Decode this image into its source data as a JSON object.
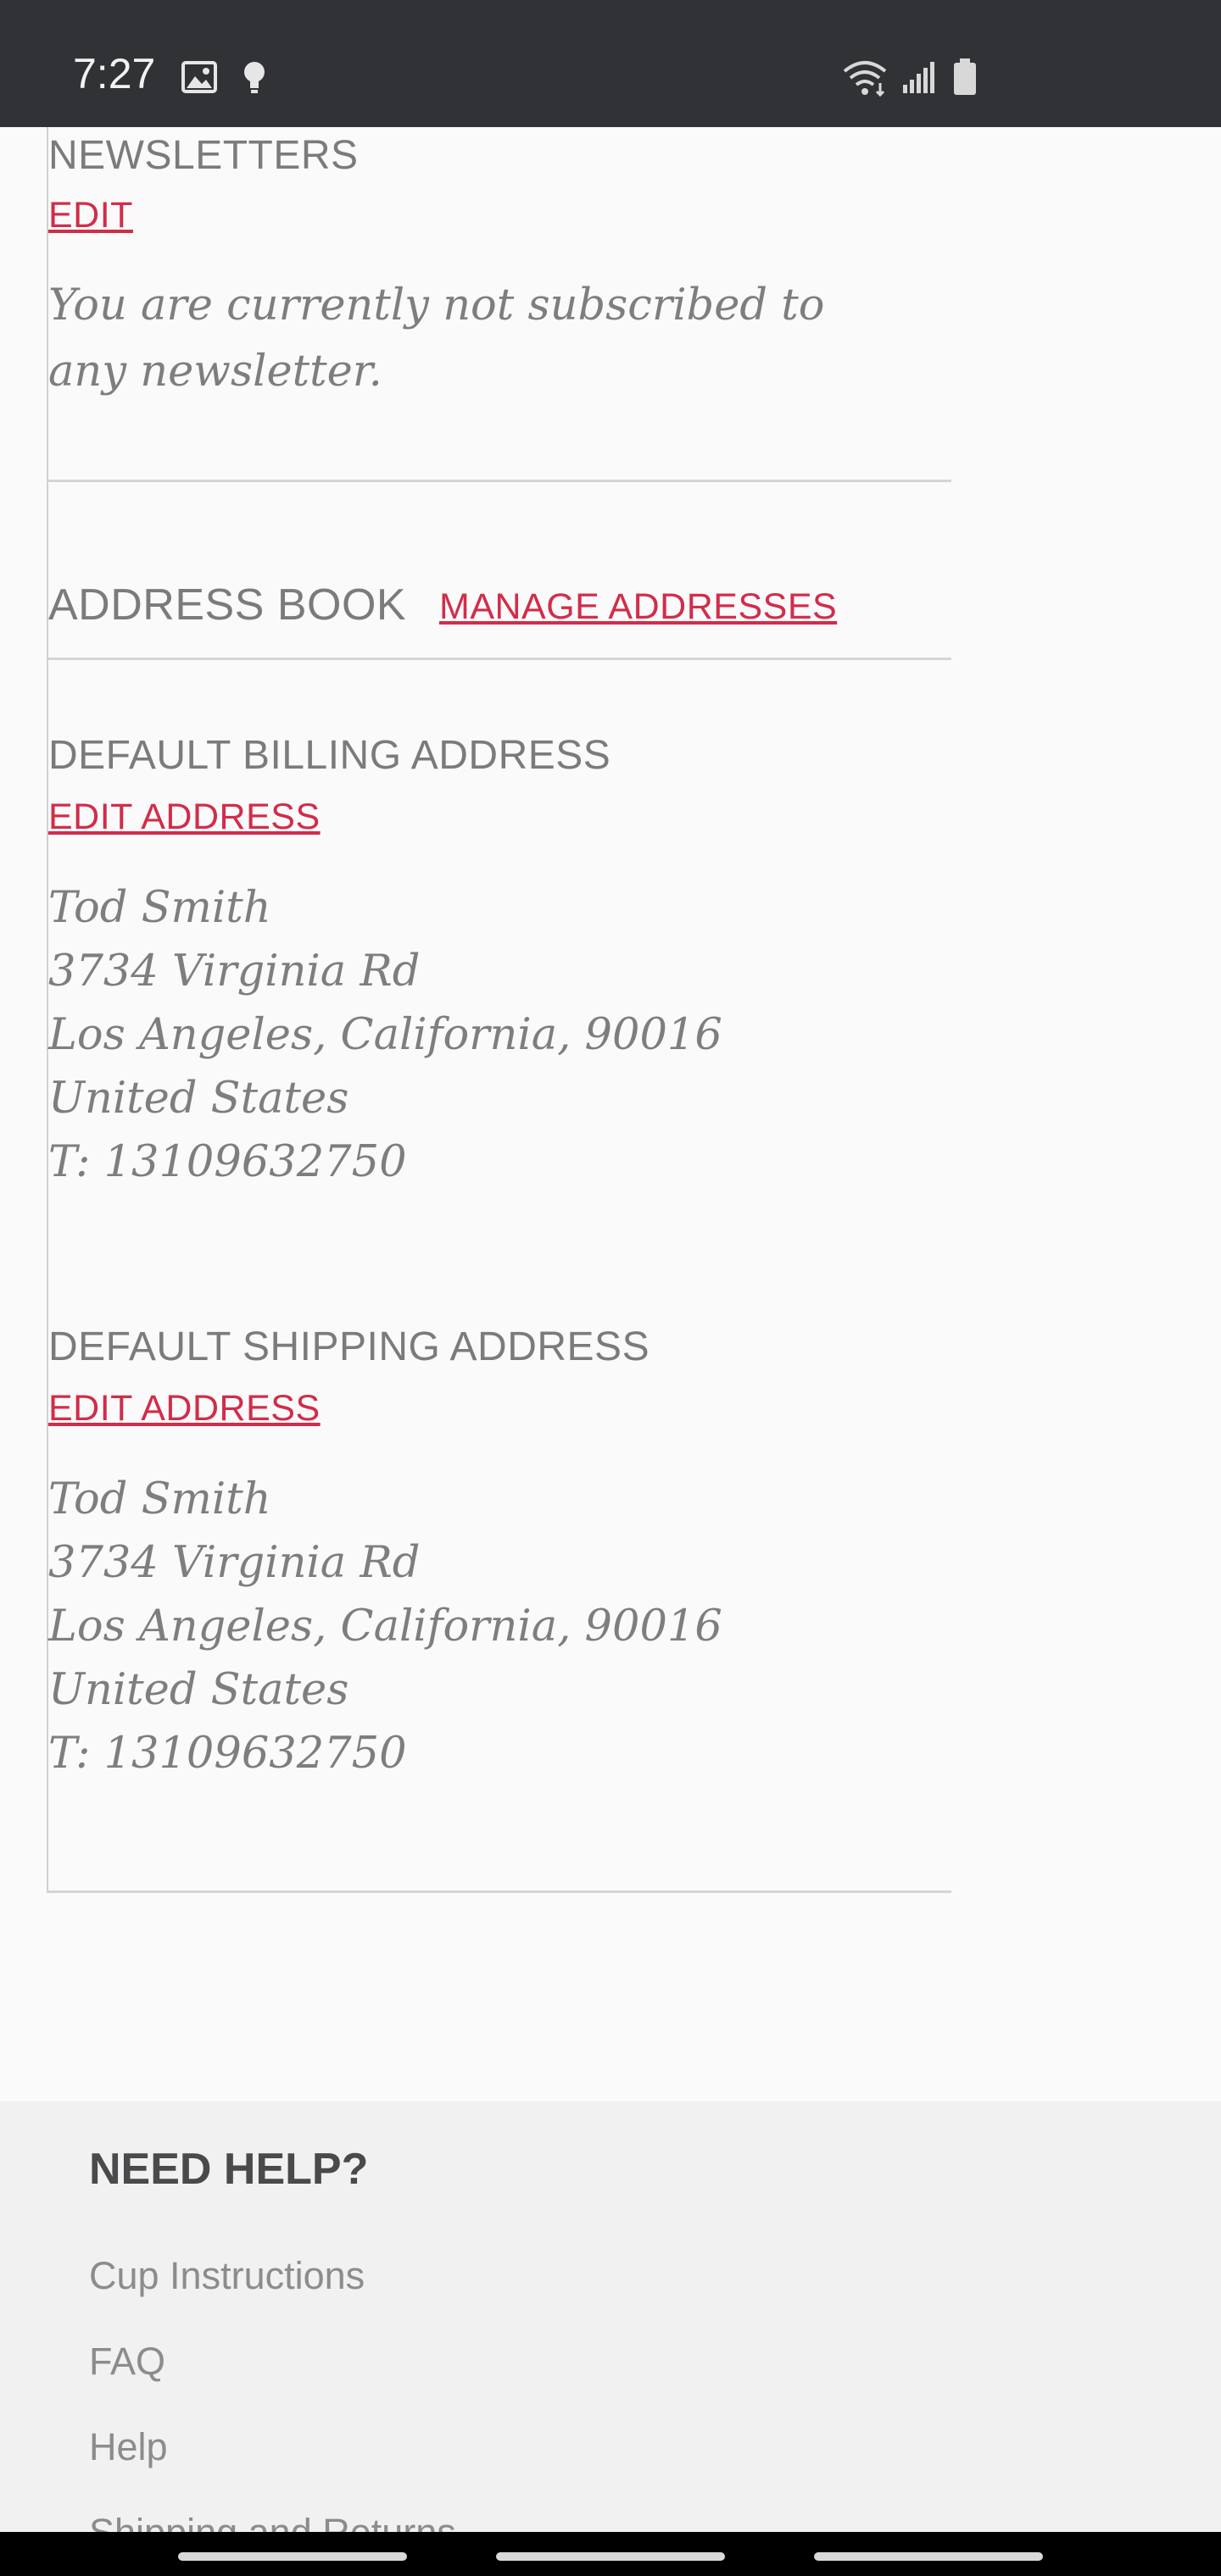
{
  "status_bar": {
    "time": "7:27",
    "icons": [
      "image-icon",
      "bulb-icon",
      "wifi-icon",
      "signal-icon",
      "battery-icon"
    ]
  },
  "newsletters": {
    "title": "NEWSLETTERS",
    "edit_label": "EDIT",
    "message": "You are currently not subscribed to any newsletter."
  },
  "address_book": {
    "title": "ADDRESS BOOK",
    "manage_label": "MANAGE ADDRESSES"
  },
  "billing": {
    "title": "DEFAULT BILLING ADDRESS",
    "edit_label": "EDIT ADDRESS",
    "lines": [
      "Tod Smith",
      "3734 Virginia Rd",
      "Los Angeles, California, 90016",
      "United States",
      "T: 13109632750"
    ]
  },
  "shipping": {
    "title": "DEFAULT SHIPPING ADDRESS",
    "edit_label": "EDIT ADDRESS",
    "lines": [
      "Tod Smith",
      "3734 Virginia Rd",
      "Los Angeles, California, 90016",
      "United States",
      "T: 13109632750"
    ]
  },
  "footer": {
    "title": "NEED HELP?",
    "links": [
      "Cup Instructions",
      "FAQ",
      "Help",
      "Shipping and Returns"
    ]
  },
  "colors": {
    "accent": "#d12d4a",
    "status_bar": "#313236",
    "text_gray": "#7b7b7b"
  }
}
